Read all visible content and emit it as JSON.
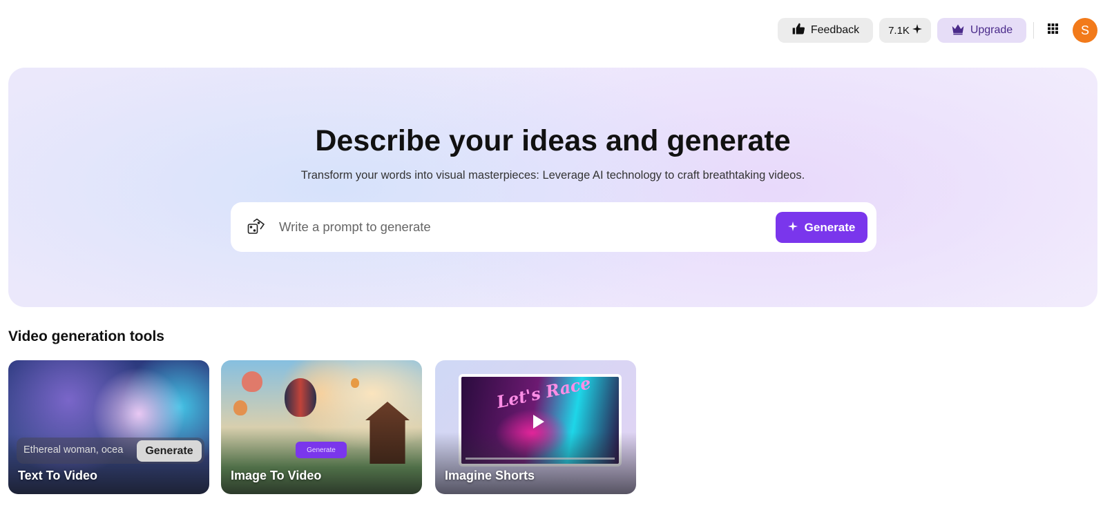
{
  "header": {
    "feedback_label": "Feedback",
    "credits_label": "7.1K",
    "upgrade_label": "Upgrade",
    "avatar_initial": "S"
  },
  "hero": {
    "title": "Describe your ideas and generate",
    "subtitle": "Transform your words into visual masterpieces: Leverage AI technology to craft breathtaking videos.",
    "prompt_placeholder": "Write a prompt to generate",
    "generate_label": "Generate"
  },
  "tools": {
    "section_title": "Video generation tools",
    "cards": [
      {
        "label": "Text To Video",
        "prompt_text": "Ethereal woman, ocea",
        "button_label": "Generate"
      },
      {
        "label": "Image To Video",
        "button_label": "Generate"
      },
      {
        "label": "Imagine Shorts",
        "overlay_text": "Let's Race"
      }
    ]
  },
  "colors": {
    "accent": "#7a36ec",
    "avatar": "#f27a1a",
    "upgrade_bg": "#e6ddf7"
  }
}
